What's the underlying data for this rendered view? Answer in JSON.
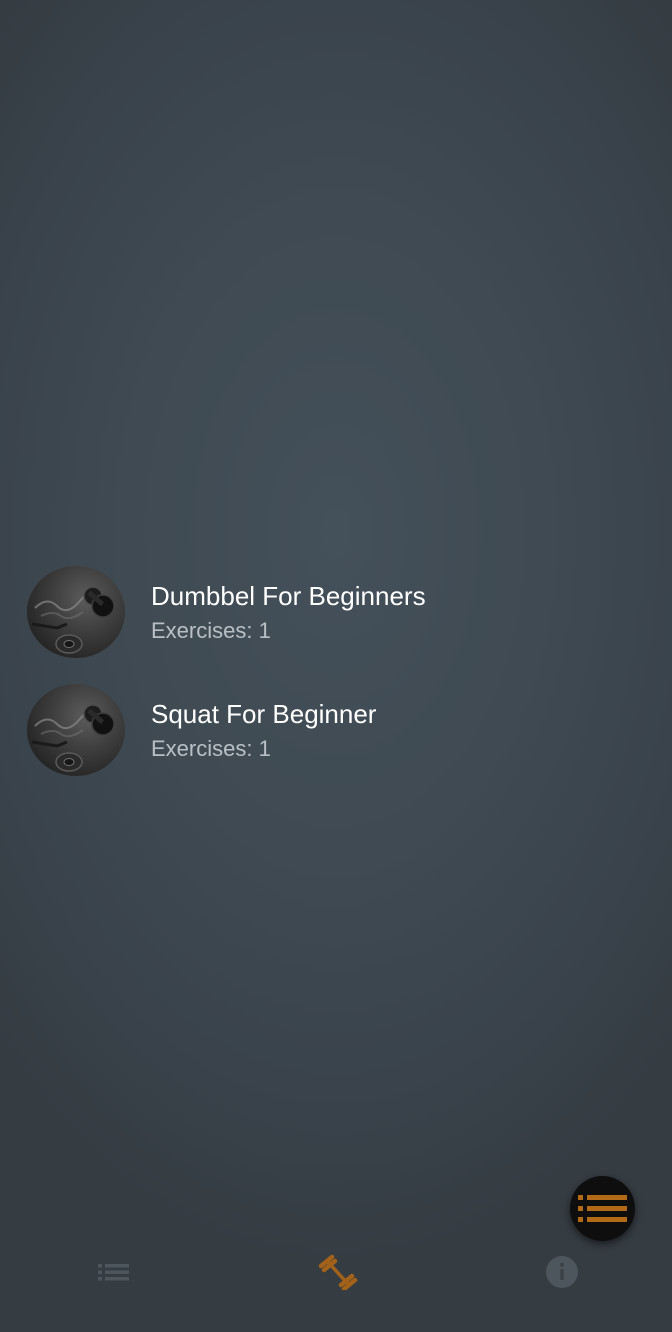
{
  "workouts": [
    {
      "title": "Dumbbel For Beginners",
      "subtitle": "Exercises: 1",
      "image": "dumbbell-photo"
    },
    {
      "title": "Squat For Beginner",
      "subtitle": "Exercises: 1",
      "image": "dumbbell-photo"
    }
  ],
  "fab": {
    "icon": "list-icon",
    "color": "#b26a17"
  },
  "bottom_nav": [
    {
      "name": "workouts",
      "icon": "list-icon",
      "active": false
    },
    {
      "name": "exercises",
      "icon": "dumbbell-icon",
      "active": true,
      "color": "#a3621a"
    },
    {
      "name": "info",
      "icon": "info-icon",
      "active": false
    }
  ]
}
